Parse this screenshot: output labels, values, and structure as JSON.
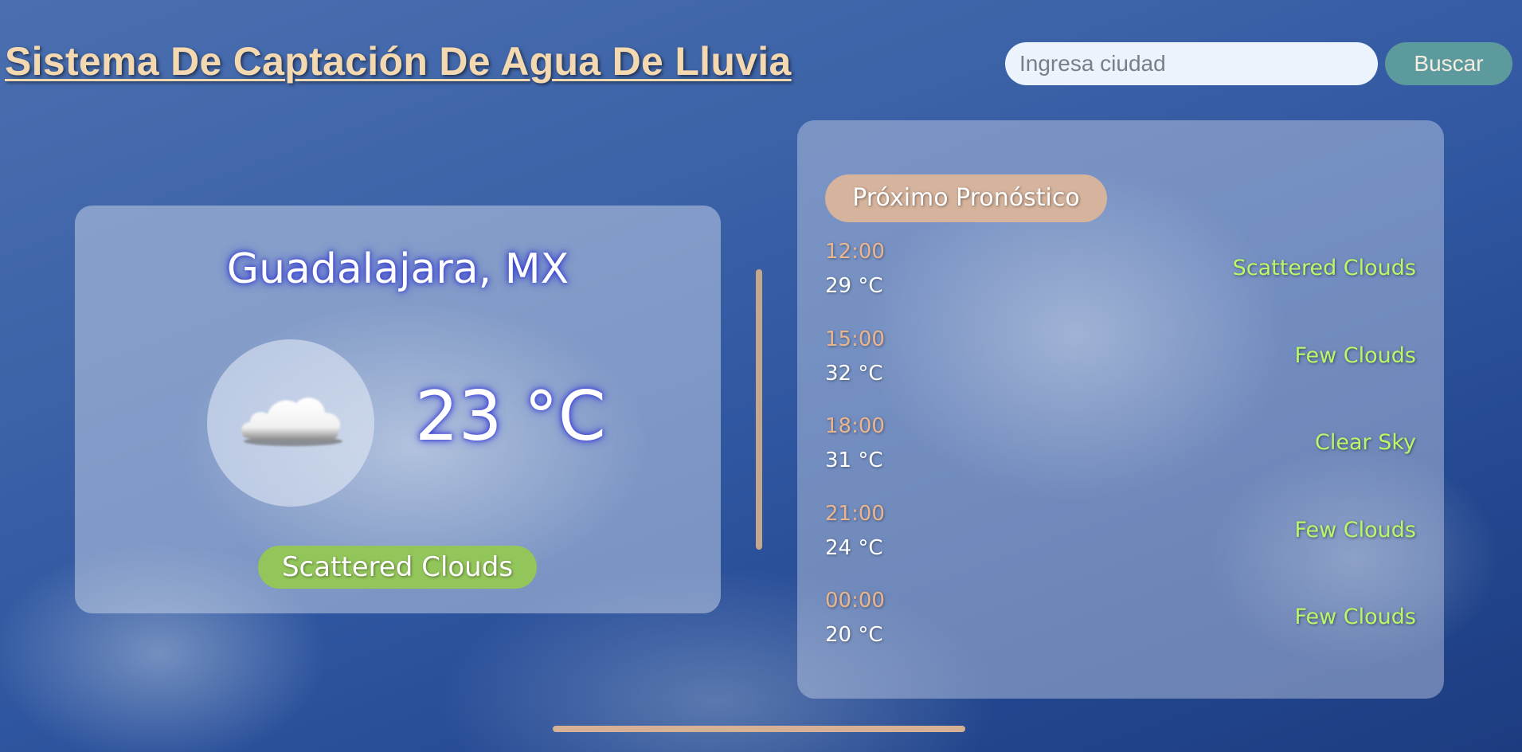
{
  "header": {
    "title": "Sistema De Captación De Agua De Lluvia"
  },
  "search": {
    "placeholder": "Ingresa ciudad",
    "value": "",
    "button_label": "Buscar"
  },
  "current": {
    "city": "Guadalajara, MX",
    "temperature": "23 °C",
    "description": "Scattered Clouds",
    "icon": "cloud-icon"
  },
  "forecast": {
    "header": "Próximo Pronóstico",
    "items": [
      {
        "time": "12:00",
        "temp": "29 °C",
        "desc": "Scattered Clouds"
      },
      {
        "time": "15:00",
        "temp": "32 °C",
        "desc": "Few Clouds"
      },
      {
        "time": "18:00",
        "temp": "31 °C",
        "desc": "Clear Sky"
      },
      {
        "time": "21:00",
        "temp": "24 °C",
        "desc": "Few Clouds"
      },
      {
        "time": "00:00",
        "temp": "20 °C",
        "desc": "Few Clouds"
      }
    ]
  },
  "colors": {
    "title": "#f4d9b0",
    "button": "#5d9a9e",
    "description_badge": "#93c65a",
    "forecast_header": "#d5b39c",
    "forecast_time": "#e9b590",
    "forecast_desc": "#b8f86a",
    "scrollbar": "#c5a88c"
  }
}
